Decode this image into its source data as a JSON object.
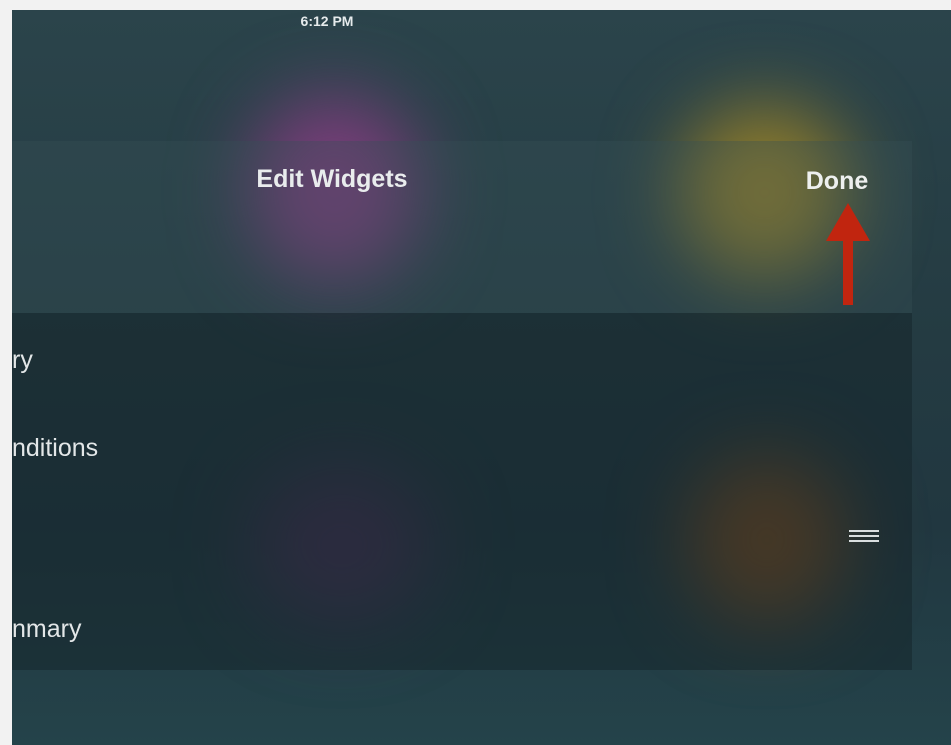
{
  "status_bar": {
    "time": "6:12 PM"
  },
  "header": {
    "title": "Edit Widgets",
    "done_label": "Done"
  },
  "widgets": {
    "items": [
      {
        "label": "ry"
      },
      {
        "label": "nditions"
      },
      {
        "label": ""
      },
      {
        "label": "nmary"
      }
    ],
    "drag_handle_icon": "reorder-icon"
  },
  "annotation": {
    "arrow_color": "#c1250f"
  }
}
